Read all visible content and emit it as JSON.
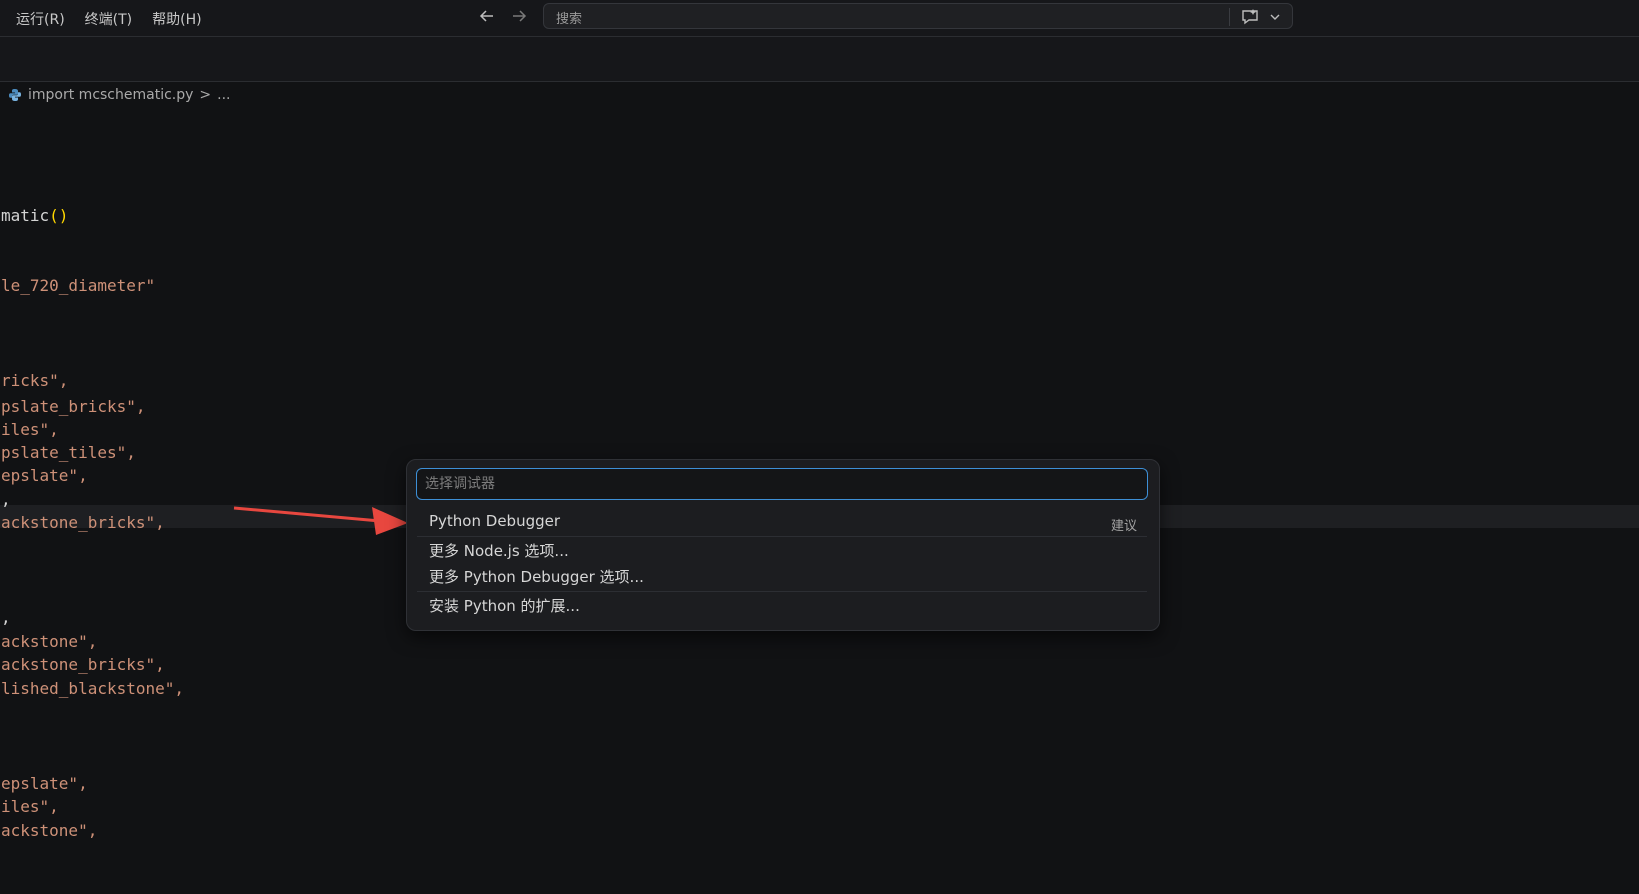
{
  "menu": [
    "运行(R)",
    "终端(T)",
    "帮助(H)"
  ],
  "search": {
    "text": "搜索"
  },
  "breadcrumb": {
    "file": "import mcschematic.py",
    "sep": ">",
    "more": "..."
  },
  "code": {
    "line1": "matic",
    "line1_paren": "()",
    "line2": "le_720_diameter\"",
    "line3": "ricks\",",
    "line4": "pslate_bricks\",",
    "line5": "iles\",",
    "line6": "pslate_tiles\",",
    "line7": "epslate\",",
    "line8": ",",
    "line9": "ackstone_bricks\",",
    "line10": ",",
    "line11": "ackstone\",",
    "line12": "ackstone_bricks\",",
    "line13": "lished_blackstone\",",
    "line14": "epslate\",",
    "line15": "iles\",",
    "line16": "ackstone\","
  },
  "picker": {
    "placeholder": "选择调试器",
    "items": [
      {
        "label": "Python Debugger",
        "tag": "建议"
      },
      {
        "label": "更多 Node.js 选项..."
      },
      {
        "label": "更多 Python Debugger 选项..."
      },
      {
        "label": "安装 Python 的扩展..."
      }
    ]
  },
  "colors": {
    "accent": "#3d8fd6",
    "arrow": "#e8473f",
    "string": "#ce9178"
  }
}
